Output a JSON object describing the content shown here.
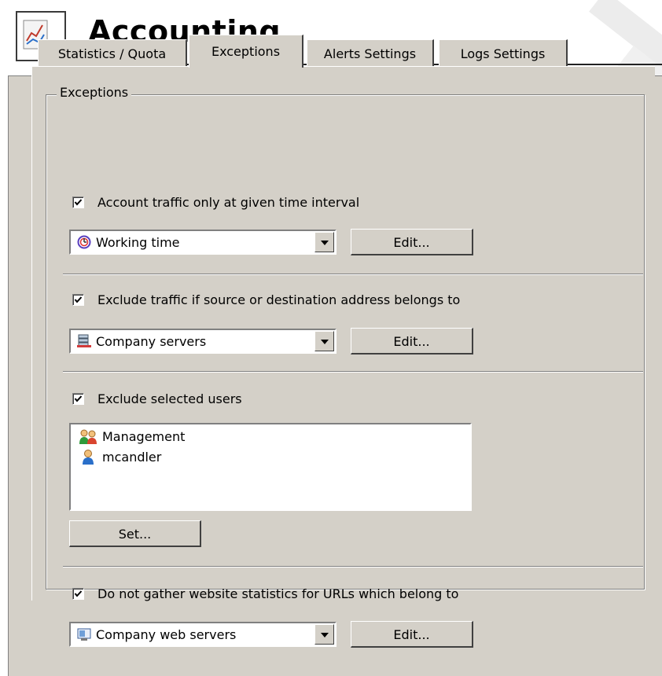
{
  "header": {
    "title": "Accounting",
    "icon": "accounting-chart-icon"
  },
  "tabs": [
    {
      "label": "Statistics / Quota",
      "active": false
    },
    {
      "label": "Exceptions",
      "active": true
    },
    {
      "label": "Alerts Settings",
      "active": false
    },
    {
      "label": "Logs Settings",
      "active": false
    }
  ],
  "exceptions": {
    "group_label": "Exceptions",
    "time_interval": {
      "checkbox_label": "Account traffic only at given time interval",
      "checked": true,
      "selected": "Working time",
      "select_icon": "clock-icon",
      "edit_label": "Edit..."
    },
    "address_group": {
      "checkbox_label": "Exclude traffic if source or destination address belongs to",
      "checked": true,
      "selected": "Company servers",
      "select_icon": "servers-icon",
      "edit_label": "Edit..."
    },
    "users": {
      "checkbox_label": "Exclude selected users",
      "checked": true,
      "items": [
        {
          "label": "Management",
          "icon": "user-group-icon"
        },
        {
          "label": "mcandler",
          "icon": "user-icon"
        }
      ],
      "set_label": "Set..."
    },
    "url_group": {
      "checkbox_label": "Do not gather website statistics for URLs which belong to",
      "checked": true,
      "selected": "Company web servers",
      "select_icon": "web-servers-icon",
      "edit_label": "Edit..."
    }
  },
  "colors": {
    "panel_bg": "#d4d0c8",
    "list_bg": "#ffffff"
  }
}
